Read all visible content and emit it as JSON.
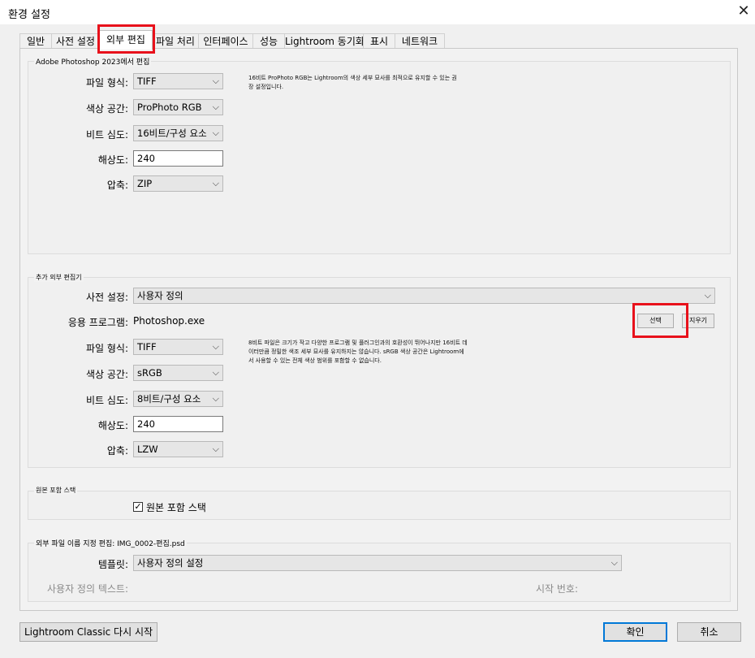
{
  "window": {
    "title": "환경 설정",
    "close_icon": "close-icon"
  },
  "tabs": [
    {
      "label": "일반"
    },
    {
      "label": "사전 설정"
    },
    {
      "label": "외부 편집",
      "active": true
    },
    {
      "label": "파일 처리"
    },
    {
      "label": "인터페이스"
    },
    {
      "label": "성능"
    },
    {
      "label": "Lightroom 동기화"
    },
    {
      "label": "표시"
    },
    {
      "label": "네트워크"
    }
  ],
  "photoshop_section": {
    "legend": "Adobe Photoshop 2023에서 편집",
    "file_format_label": "파일 형식:",
    "file_format": "TIFF",
    "color_space_label": "색상 공간:",
    "color_space": "ProPhoto RGB",
    "bit_depth_label": "비트 심도:",
    "bit_depth": "16비트/구성 요소",
    "resolution_label": "해상도:",
    "resolution": "240",
    "compression_label": "압축:",
    "compression": "ZIP",
    "note_line1": "16비트 ProPhoto RGB는 Lightroom의 색상 세부 묘사를 최적으로 유지할 수 있는 권",
    "note_line2": "장 설정입니다."
  },
  "additional_editor": {
    "legend": "추가 외부 편집기",
    "preset_label": "사전 설정:",
    "preset": "사용자 정의",
    "application_label": "응용 프로그램:",
    "application": "Photoshop.exe",
    "choose_button": "선택",
    "clear_button": "지우기",
    "file_format_label": "파일 형식:",
    "file_format": "TIFF",
    "color_space_label": "색상 공간:",
    "color_space": "sRGB",
    "bit_depth_label": "비트 심도:",
    "bit_depth": "8비트/구성 요소",
    "resolution_label": "해상도:",
    "resolution": "240",
    "compression_label": "압축:",
    "compression": "LZW",
    "note_line1": "8비트 파일은 크기가 작고 다양한 프로그램 및 플러그인과의 호환성이 뛰어나지만 16비트 데",
    "note_line2": "이터만큼 정밀한 색조 세부 묘사를 유지하지는 않습니다. sRGB 색상 공간은 Lightroom에",
    "note_line3": "서 사용할 수 있는 전체 색상 범위를 포함할 수 없습니다."
  },
  "stack_section": {
    "legend": "원본 포함 스택",
    "checkbox_label": "원본 포함 스택",
    "checked": true
  },
  "naming_section": {
    "legend": "외부 파일 이름 지정 편집: IMG_0002-편집.psd",
    "template_label": "템플릿:",
    "template": "사용자 정의 설정",
    "custom_text_label": "사용자 정의 텍스트:",
    "start_number_label": "시작 번호:"
  },
  "footer": {
    "restart_button": "Lightroom Classic 다시 시작",
    "ok_button": "확인",
    "cancel_button": "취소"
  },
  "colors": {
    "highlight": "#e8111b",
    "primary_focus": "#0078d7"
  }
}
